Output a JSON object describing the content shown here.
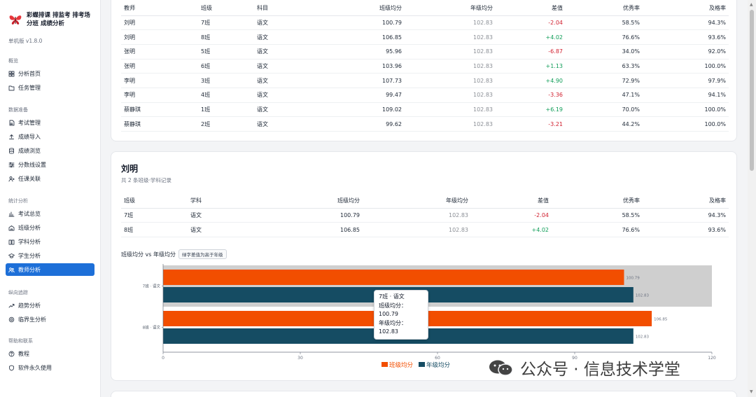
{
  "app": {
    "title": "彩蝶排课 排监考 排考场 分班 成绩分析",
    "version": "单机版 v1.8.0"
  },
  "sidebar": {
    "groups": [
      {
        "label": "概览",
        "items": [
          {
            "label": "分析首页",
            "icon": "grid-icon"
          },
          {
            "label": "任务管理",
            "icon": "folder-icon"
          }
        ]
      },
      {
        "label": "数据准备",
        "items": [
          {
            "label": "考试管理",
            "icon": "document-icon"
          },
          {
            "label": "成绩导入",
            "icon": "upload-icon"
          },
          {
            "label": "成绩浏览",
            "icon": "database-icon"
          },
          {
            "label": "分数线设置",
            "icon": "sliders-icon"
          },
          {
            "label": "任课关联",
            "icon": "user-link-icon"
          }
        ]
      },
      {
        "label": "统计分析",
        "items": [
          {
            "label": "考试总览",
            "icon": "bar-chart-icon"
          },
          {
            "label": "班级分析",
            "icon": "school-icon"
          },
          {
            "label": "学科分析",
            "icon": "book-icon"
          },
          {
            "label": "学生分析",
            "icon": "graduation-cap-icon"
          },
          {
            "label": "教师分析",
            "icon": "users-icon",
            "active": true
          }
        ]
      },
      {
        "label": "纵向追踪",
        "items": [
          {
            "label": "趋势分析",
            "icon": "trend-icon"
          },
          {
            "label": "临界生分析",
            "icon": "target-icon"
          }
        ]
      },
      {
        "label": "帮助和联系",
        "items": [
          {
            "label": "教程",
            "icon": "help-icon"
          },
          {
            "label": "软件永久使用",
            "icon": "shield-icon"
          }
        ]
      }
    ]
  },
  "summary_table": {
    "headers": [
      "教师",
      "班级",
      "科目",
      "班级均分",
      "年级均分",
      "差值",
      "优秀率",
      "及格率"
    ],
    "rows": [
      [
        "刘明",
        "7班",
        "语文",
        "100.79",
        "102.83",
        "-2.04",
        "58.5%",
        "94.3%"
      ],
      [
        "刘明",
        "8班",
        "语文",
        "106.85",
        "102.83",
        "+4.02",
        "76.6%",
        "93.6%"
      ],
      [
        "张明",
        "5班",
        "语文",
        "95.96",
        "102.83",
        "-6.87",
        "34.0%",
        "92.0%"
      ],
      [
        "张明",
        "6班",
        "语文",
        "103.96",
        "102.83",
        "+1.13",
        "63.3%",
        "100.0%"
      ],
      [
        "李明",
        "3班",
        "语文",
        "107.73",
        "102.83",
        "+4.90",
        "72.9%",
        "97.9%"
      ],
      [
        "李明",
        "4班",
        "语文",
        "99.47",
        "102.83",
        "-3.36",
        "47.1%",
        "94.1%"
      ],
      [
        "蔡静琪",
        "1班",
        "语文",
        "109.02",
        "102.83",
        "+6.19",
        "70.0%",
        "100.0%"
      ],
      [
        "蔡静琪",
        "2班",
        "语文",
        "99.62",
        "102.83",
        "-3.21",
        "44.2%",
        "100.0%"
      ]
    ]
  },
  "teacher_card": {
    "name": "刘明",
    "subtitle": "共 2 条班级·学科记录",
    "headers": [
      "班级",
      "学科",
      "班级均分",
      "年级均分",
      "差值",
      "优秀率",
      "及格率"
    ],
    "rows": [
      [
        "7班",
        "语文",
        "100.79",
        "102.83",
        "-2.04",
        "58.5%",
        "94.3%"
      ],
      [
        "8班",
        "语文",
        "106.85",
        "102.83",
        "+4.02",
        "76.6%",
        "93.6%"
      ]
    ],
    "chart_title": "班级均分 vs 年级均分",
    "chart_chip": "绿字差值为高于年级"
  },
  "colors": {
    "accent": "#1d6fd8",
    "class_bar": "#f24e00",
    "grade_bar": "#154c63",
    "negative": "#d1202f",
    "positive": "#0f9d58"
  },
  "chart_data": {
    "type": "bar",
    "orientation": "horizontal",
    "categories": [
      "7班 · 语文",
      "8班 · 语文"
    ],
    "series": [
      {
        "name": "班级均分",
        "values": [
          100.79,
          106.85
        ]
      },
      {
        "name": "年级均分",
        "values": [
          102.83,
          102.83
        ]
      }
    ],
    "xlim": [
      0,
      120
    ],
    "xticks": [
      0,
      30,
      60,
      90,
      120
    ],
    "legend": "bottom-center",
    "highlighted_category": "7班 · 语文"
  },
  "tooltip": {
    "title": "7班 · 语文",
    "line1": "班级均分：100.79",
    "line2": "年级均分：102.83"
  },
  "watermark": {
    "text": "公众号 · 信息技术学堂"
  }
}
